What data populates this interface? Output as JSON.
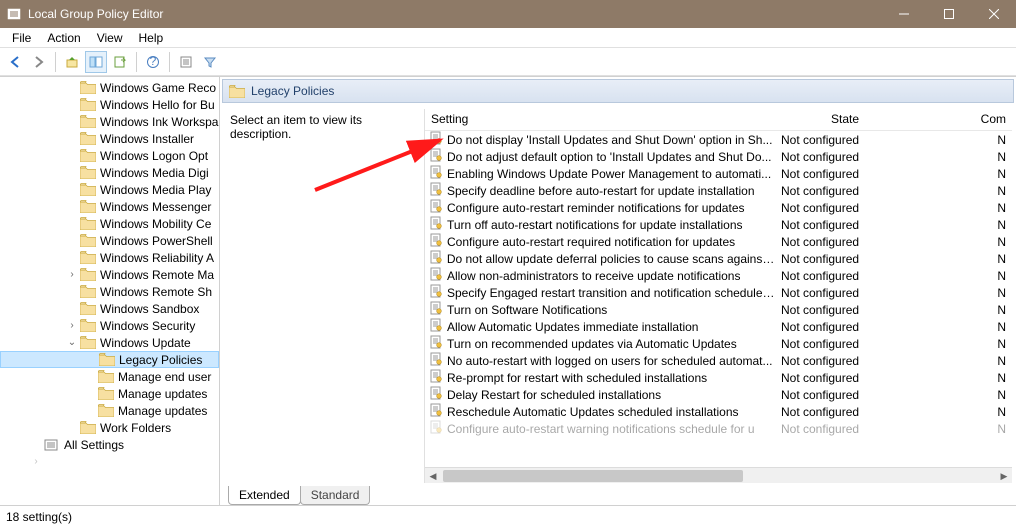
{
  "window": {
    "title": "Local Group Policy Editor"
  },
  "menu": [
    "File",
    "Action",
    "View",
    "Help"
  ],
  "status": "18 setting(s)",
  "detail": {
    "header": "Legacy Policies",
    "prompt": "Select an item to view its description.",
    "columns": {
      "setting": "Setting",
      "state": "State",
      "comment": "Com"
    },
    "tabs": {
      "extended": "Extended",
      "standard": "Standard"
    }
  },
  "tree": [
    {
      "label": "Windows Game Reco",
      "depth": 1
    },
    {
      "label": "Windows Hello for Bu",
      "depth": 1
    },
    {
      "label": "Windows Ink Workspa",
      "depth": 1
    },
    {
      "label": "Windows Installer",
      "depth": 1
    },
    {
      "label": "Windows Logon Opt",
      "depth": 1
    },
    {
      "label": "Windows Media Digi",
      "depth": 1
    },
    {
      "label": "Windows Media Play",
      "depth": 1
    },
    {
      "label": "Windows Messenger",
      "depth": 1
    },
    {
      "label": "Windows Mobility Ce",
      "depth": 1
    },
    {
      "label": "Windows PowerShell",
      "depth": 1
    },
    {
      "label": "Windows Reliability A",
      "depth": 1
    },
    {
      "label": "Windows Remote Ma",
      "depth": 1,
      "exp": ">"
    },
    {
      "label": "Windows Remote Sh",
      "depth": 1
    },
    {
      "label": "Windows Sandbox",
      "depth": 1
    },
    {
      "label": "Windows Security",
      "depth": 1,
      "exp": ">"
    },
    {
      "label": "Windows Update",
      "depth": 1,
      "exp": "v"
    },
    {
      "label": "Legacy Policies",
      "depth": 2,
      "sel": true
    },
    {
      "label": "Manage end user",
      "depth": 2
    },
    {
      "label": "Manage updates",
      "depth": 2
    },
    {
      "label": "Manage updates",
      "depth": 2
    },
    {
      "label": "Work Folders",
      "depth": 1
    },
    {
      "label": "All Settings",
      "depth": 0,
      "icon": "settings"
    }
  ],
  "settings": [
    {
      "name": "Do not display 'Install Updates and Shut Down' option in Sh...",
      "state": "Not configured",
      "c": "N"
    },
    {
      "name": "Do not adjust default option to 'Install Updates and Shut Do...",
      "state": "Not configured",
      "c": "N"
    },
    {
      "name": "Enabling Windows Update Power Management to automati...",
      "state": "Not configured",
      "c": "N"
    },
    {
      "name": "Specify deadline before auto-restart for update installation",
      "state": "Not configured",
      "c": "N"
    },
    {
      "name": "Configure auto-restart reminder notifications for updates",
      "state": "Not configured",
      "c": "N"
    },
    {
      "name": "Turn off auto-restart notifications for update installations",
      "state": "Not configured",
      "c": "N"
    },
    {
      "name": "Configure auto-restart required notification for updates",
      "state": "Not configured",
      "c": "N"
    },
    {
      "name": "Do not allow update deferral policies to cause scans against ...",
      "state": "Not configured",
      "c": "N"
    },
    {
      "name": "Allow non-administrators to receive update notifications",
      "state": "Not configured",
      "c": "N"
    },
    {
      "name": "Specify Engaged restart transition and notification schedule ...",
      "state": "Not configured",
      "c": "N"
    },
    {
      "name": "Turn on Software Notifications",
      "state": "Not configured",
      "c": "N"
    },
    {
      "name": "Allow Automatic Updates immediate installation",
      "state": "Not configured",
      "c": "N"
    },
    {
      "name": "Turn on recommended updates via Automatic Updates",
      "state": "Not configured",
      "c": "N"
    },
    {
      "name": "No auto-restart with logged on users for scheduled automat...",
      "state": "Not configured",
      "c": "N"
    },
    {
      "name": "Re-prompt for restart with scheduled installations",
      "state": "Not configured",
      "c": "N"
    },
    {
      "name": "Delay Restart for scheduled installations",
      "state": "Not configured",
      "c": "N"
    },
    {
      "name": "Reschedule Automatic Updates scheduled installations",
      "state": "Not configured",
      "c": "N"
    },
    {
      "name": "Configure auto-restart warning notifications schedule for u",
      "state": "Not configured",
      "c": "N"
    }
  ]
}
